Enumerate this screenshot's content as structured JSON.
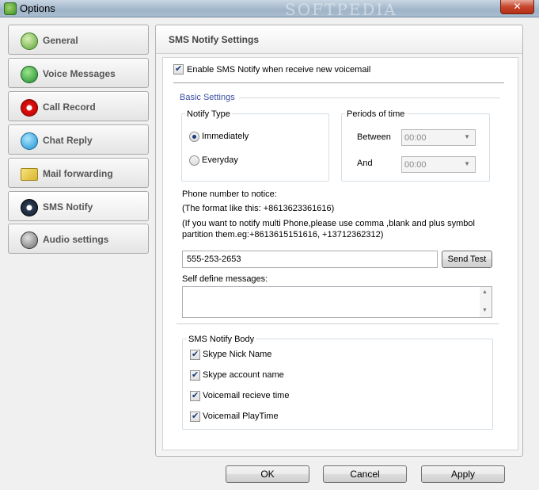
{
  "window": {
    "title": "Options",
    "watermark": "SOFTPEDIA",
    "close_label": "✕"
  },
  "sidebar": {
    "items": [
      {
        "label": "General",
        "icon": "pm-globe-icon"
      },
      {
        "label": "Voice Messages",
        "icon": "phone-icon"
      },
      {
        "label": "Call Record",
        "icon": "record-icon"
      },
      {
        "label": "Chat Reply",
        "icon": "chat-icon"
      },
      {
        "label": "Mail forwarding",
        "icon": "mail-icon"
      },
      {
        "label": "SMS Notify",
        "icon": "sms-icon"
      },
      {
        "label": "Audio settings",
        "icon": "speaker-icon"
      }
    ],
    "active_index": 5
  },
  "main": {
    "title": "SMS Notify Settings",
    "enable_label": "Enable SMS Notify when receive new voicemail",
    "enable_checked": true,
    "basic_settings": "Basic Settings",
    "notify_type": {
      "legend": "Notify Type",
      "immediately": "Immediately",
      "everyday": "Everyday",
      "selected": "Immediately"
    },
    "periods": {
      "legend": "Periods of time",
      "between_label": "Between",
      "and_label": "And",
      "between_value": "00:00",
      "and_value": "00:00"
    },
    "phone": {
      "label": "Phone number to notice:",
      "format_hint": "(The format like this: +8613623361616)",
      "multi_hint_1": "(If you want to notify multi Phone,please use comma ,blank and plus symbol",
      "multi_hint_2": "partition them.eg:+8613615151616, +13712362312)",
      "value": "555-253-2653",
      "send_test": "Send Test"
    },
    "self_define_label": "Self define messages:",
    "self_define_value": "",
    "body": {
      "legend": "SMS Notify Body",
      "items": [
        {
          "label": "Skype Nick Name",
          "checked": true
        },
        {
          "label": "Skype account name",
          "checked": true
        },
        {
          "label": "Voicemail recieve time",
          "checked": true
        },
        {
          "label": "Voicemail PlayTime",
          "checked": true
        }
      ]
    }
  },
  "footer": {
    "ok": "OK",
    "cancel": "Cancel",
    "apply": "Apply"
  }
}
